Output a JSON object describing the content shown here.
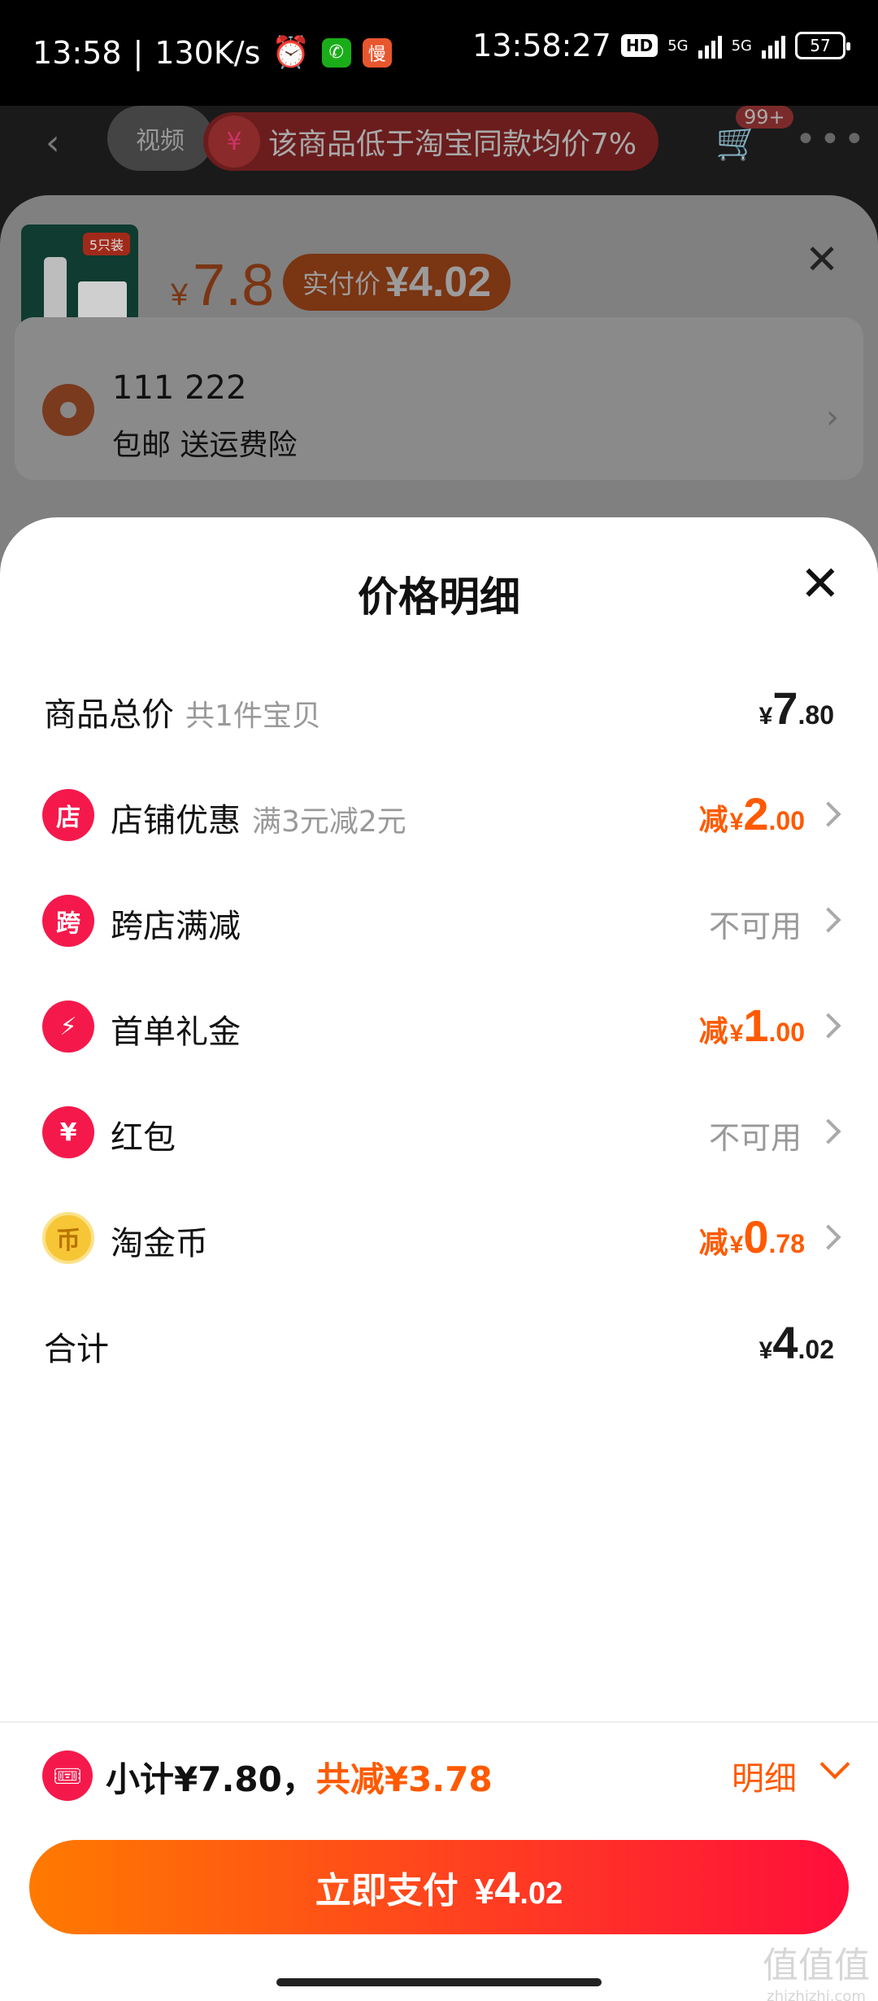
{
  "status": {
    "time_left": "13:58",
    "speed": "130K/s",
    "time_center": "13:58:27",
    "hd": "HD",
    "net1": "5G",
    "net2": "5G",
    "battery": "57",
    "app_badge": "慢"
  },
  "background": {
    "tab_video": "视频",
    "banner_text": "该商品低于淘宝同款均价7%",
    "cart_badge": "99+",
    "product_tag": "5只装",
    "price_symbol": "¥",
    "price": "7.8",
    "paid_label": "实付价",
    "paid_value": "¥4.02",
    "address_name": "111 222",
    "address_sub": "包邮 送运费险"
  },
  "sheet": {
    "title": "价格明细",
    "rows": [
      {
        "label": "商品总价",
        "sub": "共1件宝贝",
        "yen": "¥",
        "int": "7",
        "dec": ".80"
      },
      {
        "label": "店铺优惠",
        "sub": "满3元减2元",
        "icon": "店",
        "pre": "减",
        "yen": "¥",
        "int": "2",
        "dec": ".00"
      },
      {
        "label": "跨店满减",
        "icon": "跨",
        "na": "不可用"
      },
      {
        "label": "首单礼金",
        "icon": "⚡",
        "pre": "减",
        "yen": "¥",
        "int": "1",
        "dec": ".00"
      },
      {
        "label": "红包",
        "icon": "¥",
        "na": "不可用"
      },
      {
        "label": "淘金币",
        "icon": "币",
        "pre": "减",
        "yen": "¥",
        "int": "0",
        "dec": ".78"
      },
      {
        "label": "合计",
        "yen": "¥",
        "int": "4",
        "dec": ".02"
      }
    ]
  },
  "footer": {
    "subtotal_text": "小计¥7.80，",
    "discount_text": "共减¥3.78",
    "detail_label": "明细",
    "pay_label": "立即支付",
    "pay_yen": "¥",
    "pay_int": "4",
    "pay_dec": ".02"
  },
  "watermark": {
    "text": "值值值",
    "sub": "zhizhizhi.com"
  },
  "colors": {
    "accent": "#ff5a00",
    "brand_red": "#f5194b"
  }
}
